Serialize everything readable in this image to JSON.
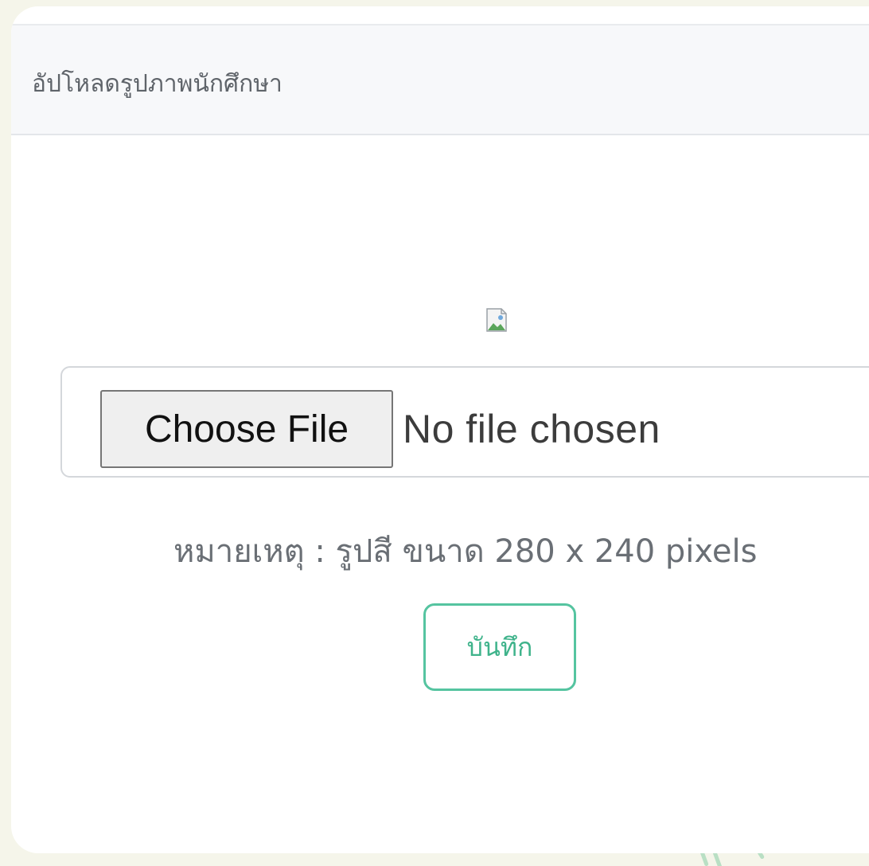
{
  "card": {
    "title": "อัปโหลดรูปภาพนักศึกษา"
  },
  "form": {
    "image_icon": "broken-image-icon",
    "file_input": {
      "button_label": "Choose File",
      "status": "No file chosen"
    },
    "note": "หมายเหตุ : รูปสี ขนาด 280 x 240 pixels",
    "save_label": "บันทึก"
  },
  "colors": {
    "accent": "#55c4a0",
    "header_bg": "#f7f8fa",
    "page_bg": "#f5f5ea"
  }
}
